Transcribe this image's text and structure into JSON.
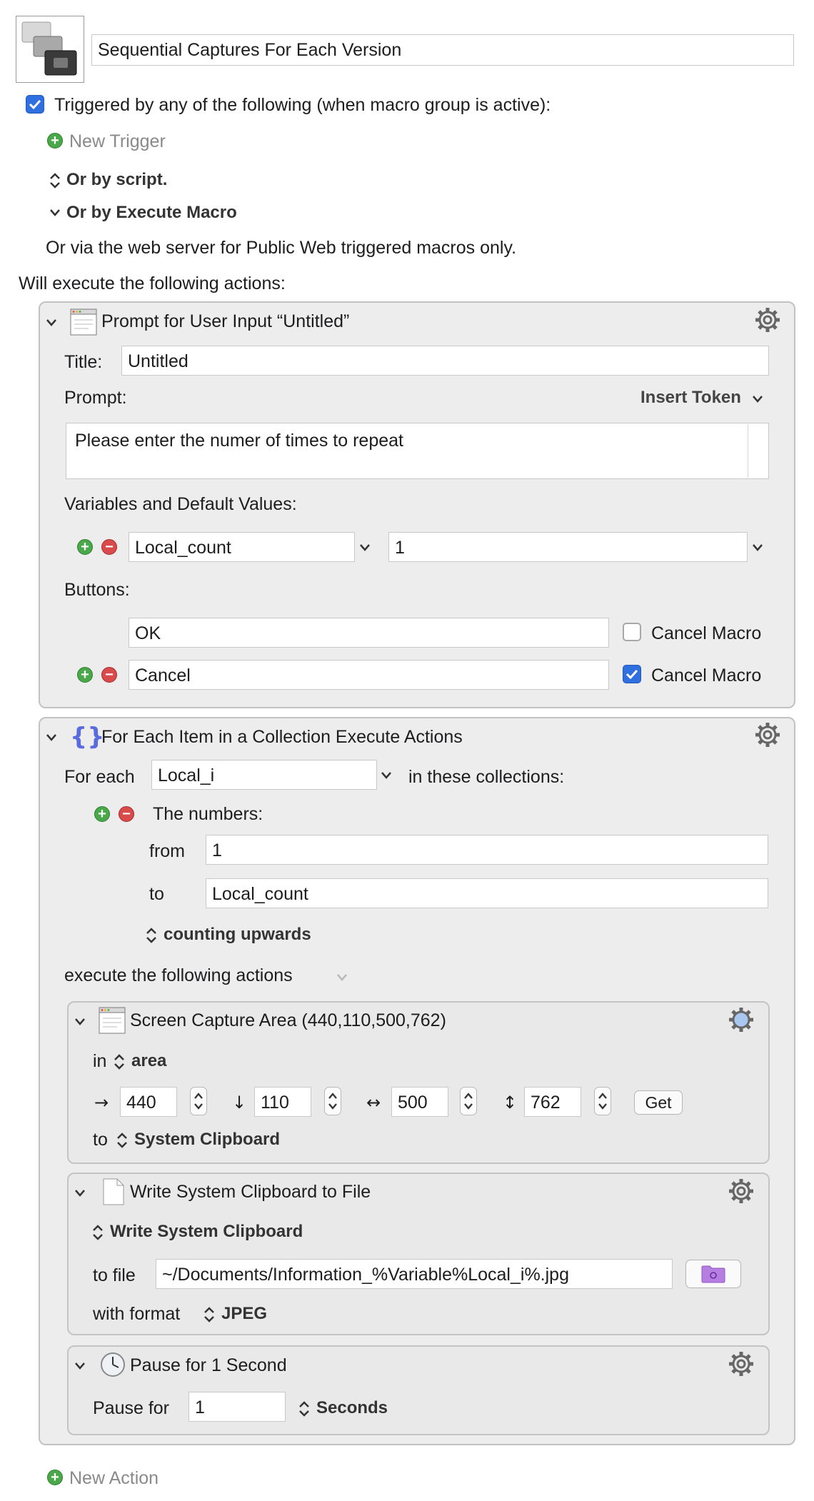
{
  "macro": {
    "name": "Sequential Captures For Each Version",
    "trigger_label": "Triggered by any of the following (when macro group is active):",
    "new_trigger": "New Trigger",
    "or_by_script": "Or by script.",
    "or_by_execute_macro": "Or by Execute Macro",
    "web_server_note": "Or via the web server for Public Web triggered macros only.",
    "will_execute": "Will execute the following actions:"
  },
  "prompt_action": {
    "header": "Prompt for User Input “Untitled”",
    "title_label": "Title:",
    "title_value": "Untitled",
    "prompt_label": "Prompt:",
    "insert_token": "Insert Token",
    "prompt_text": "Please enter the numer of times to repeat",
    "variables_label": "Variables and Default Values:",
    "variable_name": "Local_count",
    "variable_default": "1",
    "buttons_label": "Buttons:",
    "button1": "OK",
    "button2": "Cancel",
    "cancel_macro_label": "Cancel Macro"
  },
  "foreach_action": {
    "header": "For Each Item in a Collection Execute Actions",
    "for_each_label": "For each",
    "variable": "Local_i",
    "in_collections": "in these collections:",
    "numbers_label": "The numbers:",
    "from_label": "from",
    "from_value": "1",
    "to_label": "to",
    "to_value": "Local_count",
    "counting": "counting upwards",
    "execute_following": "execute the following actions"
  },
  "capture_action": {
    "header": "Screen Capture Area (440,110,500,762)",
    "in_label": "in",
    "area": "area",
    "left": "440",
    "top": "110",
    "width": "500",
    "height": "762",
    "get_button": "Get",
    "to_label": "to",
    "destination": "System Clipboard",
    "arrow_right": "→",
    "arrow_down": "↓",
    "arrow_lr": "↔",
    "arrow_ud": "↕"
  },
  "write_action": {
    "header": "Write System Clipboard to File",
    "write_mode": "Write System Clipboard",
    "to_file_label": "to file",
    "file_path": "~/Documents/Information_%Variable%Local_i%.jpg",
    "format_label": "with format",
    "format": "JPEG"
  },
  "pause_action": {
    "header": "Pause for 1 Second",
    "pause_label": "Pause for",
    "value": "1",
    "unit": "Seconds"
  },
  "footer": {
    "new_action": "New Action"
  },
  "colors": {
    "panel_bg": "#ededed",
    "checkbox_blue": "#2f6fe0",
    "plus_green": "#4aa84a",
    "minus_red": "#d94b4b",
    "folder_purple": "#b57ee0"
  }
}
